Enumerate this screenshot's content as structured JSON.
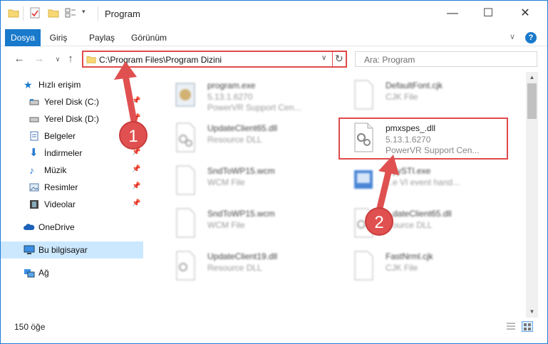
{
  "window": {
    "title": "Program"
  },
  "ribbon": {
    "tabs": [
      {
        "label": "Dosya",
        "active": true
      },
      {
        "label": "Giriş"
      },
      {
        "label": "Paylaş"
      },
      {
        "label": "Görünüm"
      }
    ]
  },
  "address": {
    "path": "C:\\Program Files\\Program Dizini"
  },
  "search": {
    "placeholder": "Ara: Program"
  },
  "sidebar": {
    "items": [
      {
        "label": "Hızlı erişim",
        "icon": "star-icon"
      },
      {
        "label": "Yerel Disk (C:)",
        "icon": "drive-icon",
        "pinned": true
      },
      {
        "label": "Yerel Disk (D:)",
        "icon": "drive-icon",
        "pinned": true
      },
      {
        "label": "Belgeler",
        "icon": "documents-icon",
        "pinned": true
      },
      {
        "label": "İndirmeler",
        "icon": "download-icon",
        "pinned": true
      },
      {
        "label": "Müzik",
        "icon": "music-icon",
        "pinned": true
      },
      {
        "label": "Resimler",
        "icon": "pictures-icon",
        "pinned": true
      },
      {
        "label": "Videolar",
        "icon": "videos-icon",
        "pinned": true
      },
      {
        "label": "OneDrive",
        "icon": "cloud-icon"
      },
      {
        "label": "Bu bilgisayar",
        "icon": "computer-icon",
        "selected": true
      },
      {
        "label": "Ağ",
        "icon": "network-icon"
      }
    ]
  },
  "files": [
    {
      "name": "program.exe",
      "line1": "5.13.1.6270",
      "line2": "PowerVR Support Cen...",
      "kind": "exe"
    },
    {
      "name": "DefaultFont.cjk",
      "line1": "CJK File",
      "kind": "doc"
    },
    {
      "name": "UpdateClient65.dll",
      "line1": "Resource DLL",
      "kind": "dll"
    },
    {
      "name": "pmxspes_.dll",
      "line1": "5.13.1.6270",
      "line2": "PowerVR Support Cen...",
      "kind": "dll",
      "highlighted": true
    },
    {
      "name": "SndToWP15.wcm",
      "line1": "WCM File",
      "kind": "doc"
    },
    {
      "name": "...yySTI.exe",
      "line1": "...e VI event hand...",
      "kind": "exe2"
    },
    {
      "name": "SndToWP15.wcm",
      "line1": "WCM File",
      "kind": "doc"
    },
    {
      "name": "...dateClient65.dll",
      "line1": "...ource DLL",
      "kind": "dll"
    },
    {
      "name": "UpdateClient19.dll",
      "line1": "Resource DLL",
      "kind": "dll"
    },
    {
      "name": "FastNrml.cjk",
      "line1": "CJK File",
      "kind": "doc"
    }
  ],
  "status": {
    "count": "150 öğe"
  },
  "annotations": {
    "badge1": "1",
    "badge2": "2"
  },
  "colors": {
    "accent": "#1979ca",
    "highlight": "#e04a4a"
  }
}
